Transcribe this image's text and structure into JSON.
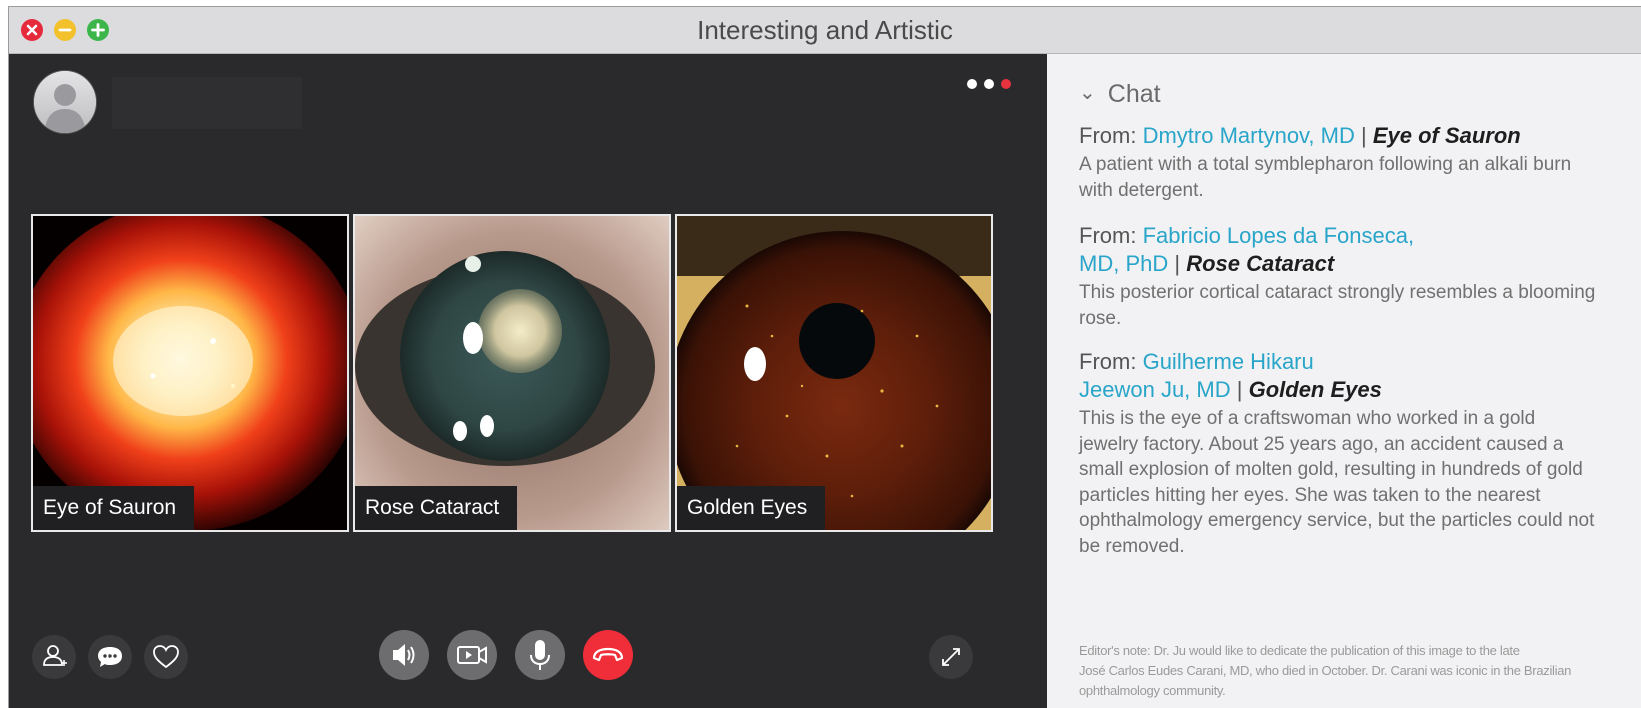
{
  "window": {
    "title": "Interesting and Artistic",
    "traffic_lights": [
      {
        "icon": "close-icon",
        "color": "#e52a3c"
      },
      {
        "icon": "minimize-icon",
        "color": "#f2c12c"
      },
      {
        "icon": "zoom-icon",
        "color": "#3cb64a"
      }
    ]
  },
  "call": {
    "participant_tiles": [
      {
        "label": "Eye of Sauron"
      },
      {
        "label": "Rose Cataract"
      },
      {
        "label": "Golden Eyes"
      }
    ],
    "left_controls": [
      "add-contact-icon",
      "chat-bubble-icon",
      "heart-icon"
    ],
    "center_controls": [
      "speaker-icon",
      "video-camera-icon",
      "microphone-icon",
      "end-call-icon"
    ],
    "right_controls": [
      "fullscreen-icon"
    ],
    "end_call_color": "#ef2e3a",
    "active_dot_color": "#e8333f"
  },
  "chat": {
    "header": "Chat",
    "messages": [
      {
        "from_prefix": "From:",
        "sender": "Dmytro Martynov, MD",
        "separator": "|",
        "title": "Eye of Sauron",
        "body": "A patient with a total symblepharon following an alkali burn with detergent."
      },
      {
        "from_prefix": "From:",
        "sender_line1": "Fabricio Lopes da Fonseca,",
        "sender_line2": "MD, PhD",
        "separator": "|",
        "title": "Rose Cataract",
        "body": "This posterior cortical cataract strongly resembles a blooming rose."
      },
      {
        "from_prefix": "From:",
        "sender_line1": "Guilherme Hikaru",
        "sender_line2": "Jeewon Ju, MD",
        "separator": "|",
        "title": "Golden Eyes",
        "body": "This is the eye of a craftswoman who worked in a gold jewelry factory. About 25 years ago, an accident caused a small explosion of molten gold, resulting in hundreds of gold particles hitting her eyes. She was taken to the nearest ophthalmology emergency service, but the particles could not be removed."
      }
    ],
    "editor_note_line1": "Editor's note: Dr. Ju would like to dedicate the publication of this image to the late",
    "editor_note_line2": "José Carlos Eudes Carani, MD, who died in October. Dr. Carani was iconic in the Brazilian ophthalmology community.",
    "link_color": "#29a5c9"
  }
}
